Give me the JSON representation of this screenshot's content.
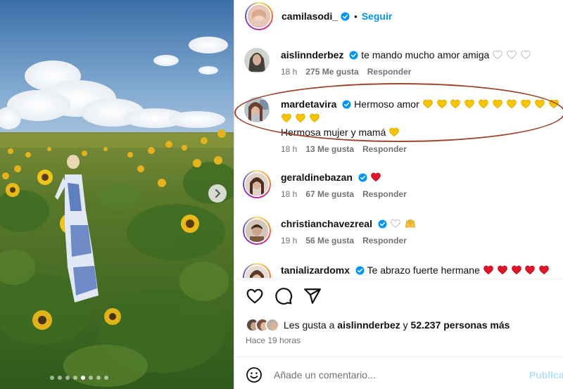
{
  "post": {
    "author": "camilasodi_",
    "separator": "•",
    "follow_label": "Seguir",
    "carousel_total": 8,
    "carousel_active": 5
  },
  "comments": [
    {
      "user": "aislinnderbez",
      "verified": true,
      "text": "te mando mucho amor amiga",
      "emoji": [
        "white-heart",
        "white-heart",
        "white-heart"
      ],
      "time": "18 h",
      "likes": "275 Me gusta",
      "reply": "Responder"
    },
    {
      "user": "mardetavira",
      "verified": true,
      "text": "Hermoso amor",
      "emoji": [
        "yellow-heart",
        "yellow-heart",
        "yellow-heart",
        "yellow-heart",
        "yellow-heart",
        "yellow-heart",
        "yellow-heart",
        "yellow-heart",
        "yellow-heart",
        "yellow-heart",
        "yellow-heart",
        "yellow-heart",
        "yellow-heart"
      ],
      "text2": "Hermosa mujer y mamá",
      "emoji2": [
        "yellow-heart"
      ],
      "time": "18 h",
      "likes": "13 Me gusta",
      "reply": "Responder",
      "highlighted": true
    },
    {
      "user": "geraldinebazan",
      "verified": true,
      "text": "",
      "emoji": [
        "red-heart"
      ],
      "time": "18 h",
      "likes": "67 Me gusta",
      "reply": "Responder"
    },
    {
      "user": "christianchavezreal",
      "verified": true,
      "text": "",
      "emoji": [
        "white-heart",
        "raised-hands"
      ],
      "time": "19 h",
      "likes": "56 Me gusta",
      "reply": "Responder"
    },
    {
      "user": "tanializardomx",
      "verified": true,
      "text": "Te abrazo fuerte hermane",
      "emoji": [
        "red-heart",
        "red-heart",
        "red-heart",
        "red-heart",
        "red-heart"
      ]
    }
  ],
  "likes": {
    "prefix": "Les gusta a",
    "user": "aislinnderbez",
    "connector": "y",
    "others": "52.237 personas más"
  },
  "time_ago": "Hace 19 horas",
  "add_comment": {
    "placeholder": "Añade un comentario...",
    "post_label": "Publicar"
  },
  "colors": {
    "accent": "#0095f6",
    "highlight_ellipse": "#a0452e",
    "verified": "#0095f6"
  }
}
